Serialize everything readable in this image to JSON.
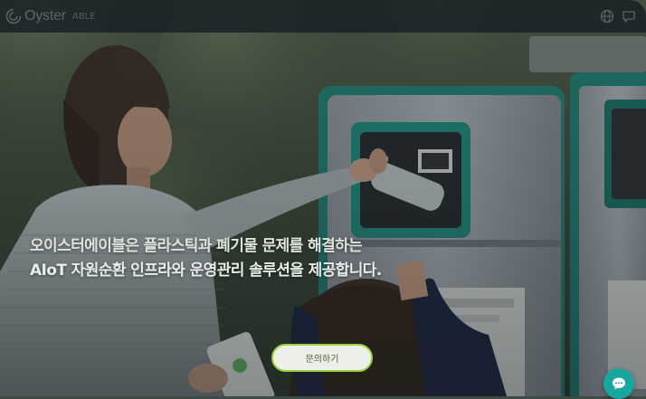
{
  "header": {
    "logo_text": "Oyster",
    "logo_sub": "ABLE",
    "icons": [
      "language-icon",
      "chat-icon"
    ]
  },
  "hero": {
    "line1": "오이스터에이블은 플라스틱과 폐기물 문제를 해결하는",
    "line2": "AIoT 자원순환 인프라와 운영관리 솔루션을 제공합니다.",
    "cta_label": "문의하기"
  },
  "chat": {
    "icon": "chat-bubble-icon"
  },
  "colors": {
    "header_bg": "#181e26",
    "cta_border": "#9bcf3c",
    "chat_fab": "#18a7a0",
    "machine_teal": "#1f8a7c"
  }
}
